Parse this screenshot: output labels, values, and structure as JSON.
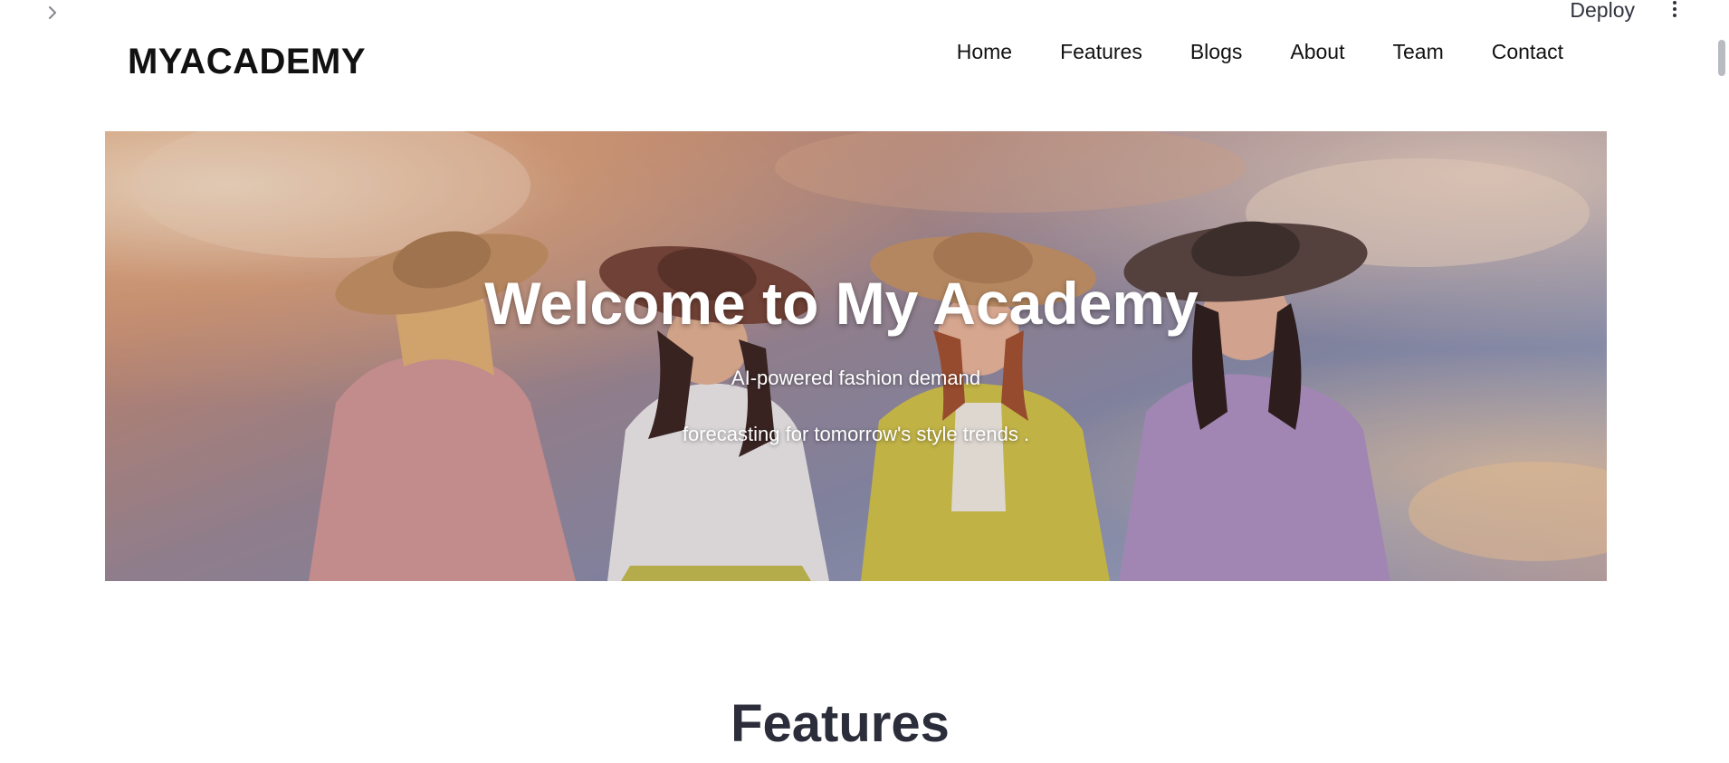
{
  "chrome": {
    "sidebar_toggle_icon": "chevron-right-icon",
    "deploy_label": "Deploy",
    "menu_icon": "kebab-menu-icon"
  },
  "navbar": {
    "brand": "MYACADEMY",
    "links": [
      "Home",
      "Features",
      "Blogs",
      "About",
      "Team",
      "Contact"
    ]
  },
  "hero": {
    "title": "Welcome to My Academy",
    "subtitle_line1": "AI-powered fashion demand",
    "subtitle_line2": "forecasting for tomorrow's style trends ."
  },
  "features": {
    "heading": "Features"
  },
  "colors": {
    "text_dark": "#111111",
    "heading": "#2b2d3a",
    "chrome_text": "#31333f"
  }
}
